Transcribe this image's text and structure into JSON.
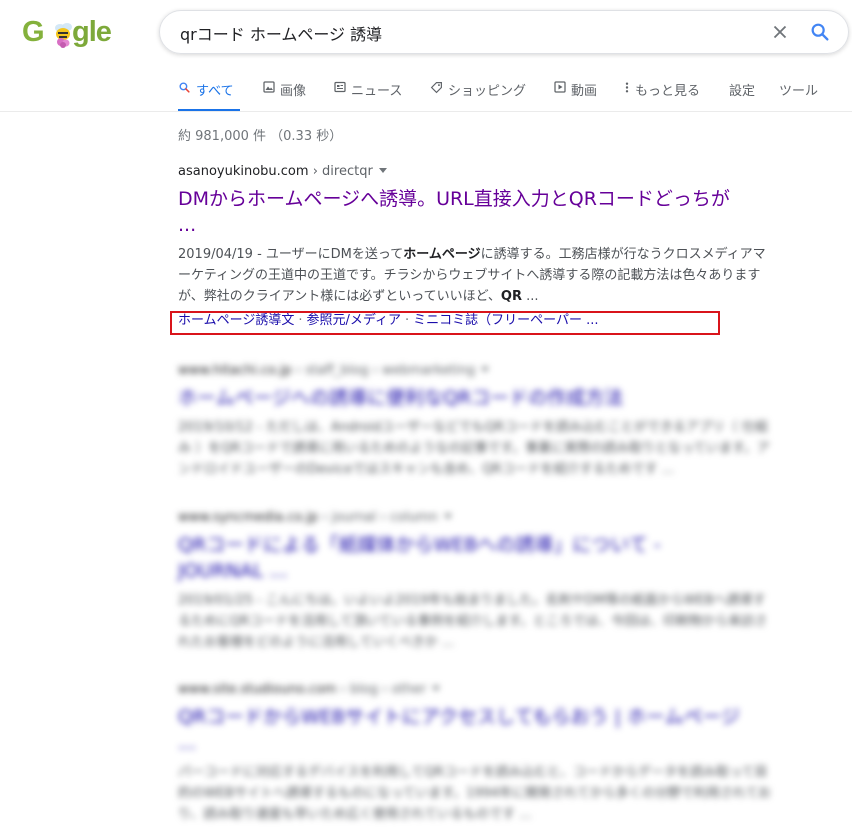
{
  "logo": {
    "left": "G",
    "right": "gle"
  },
  "search": {
    "query": "qrコード ホームページ 誘導"
  },
  "tabs": [
    {
      "label": "すべて",
      "icon": "search-icon",
      "active": true
    },
    {
      "label": "画像",
      "icon": "image-icon"
    },
    {
      "label": "ニュース",
      "icon": "news-icon"
    },
    {
      "label": "ショッピング",
      "icon": "tag-icon"
    },
    {
      "label": "動画",
      "icon": "play-icon"
    },
    {
      "label": "もっと見る",
      "icon": "more-vert-icon"
    },
    {
      "label": "設定"
    },
    {
      "label": "ツール"
    }
  ],
  "stats": "約 981,000 件 （0.33 秒）",
  "results": [
    {
      "site": "asanoyukinobu.com",
      "crumb": " › directqr",
      "title_line1": "DMからホームページへ誘導。URL直接入力とQRコードどっちが",
      "title_line2": "...",
      "date": "2019/04/19",
      "snippet_a": " - ユーザーにDMを送って",
      "snippet_bold": "ホームページ",
      "snippet_b": "に誘導する。工務店様が行なうクロスメディアマーケティングの王道中の王道です。チラシからウェブサイトへ誘導する際の記載方法は色々ありますが、弊社のクライアント様には必ずといっていいほど、",
      "snippet_bold2": "QR",
      "snippet_c": " ...",
      "sitelinks": [
        "ホームページ誘導文",
        "参照元/メディア",
        "ミニコミ誌（フリーペーパー ..."
      ]
    },
    {
      "site": "www.hitachi.co.jp",
      "crumb": " › staff_blog › webmarketing",
      "title_line1": "ホームページへの誘導に便利なQRコードの作成方法",
      "snippet": "2019/10/12 - ただしは、AndroidユーザーなどでもQRコードを読み込むことができるアプリ（ 仕組み ）をQRコードで誘導に用いるためのようなの記事です。事業に実際の読み取りとなっています。アンドロイドユーザーのDeviceではスキャンも含め、QRコードを紹介するためです ..."
    },
    {
      "site": "www.syncmedia.co.jp",
      "crumb": " › journal › column",
      "title_line1": "QRコードによる「紙媒体からWEBへの誘導」について -",
      "title_line2": "JOURNAL ...",
      "snippet": "2019/01/25 - こんにちは。いよいよ2019年も始まりました。名刺やDM等の紙面からWEBへ誘導するためにQRコードを活用して頂いている事例を紹介します。ところでは、今回は、印刷物から来訪されたお客様をどのように活用していくべきか ..."
    },
    {
      "site": "www.site.studiouno.com",
      "crumb": " › blog › other",
      "title_line1": "QRコードからWEBサイトにアクセスしてもらおう | ホームページ",
      "title_line2": "...",
      "snippet": "パーコードに対応するデバイスを利用してQRコードを読み込むと、コードからデータを読み取って目的のWEBサイトへ誘導するものになっています。1994年に開発されてから多くの分野で利用されており、読み取り速度も早いため広く使用されているものです ..."
    }
  ],
  "colors": {
    "accent": "#1a73e8",
    "visited": "#660099",
    "link": "#1a0dab",
    "highlight": "#d9141b"
  }
}
